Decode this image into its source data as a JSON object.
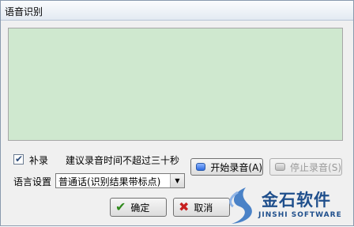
{
  "window": {
    "title": "语音识别"
  },
  "main": {
    "text_value": "",
    "supplement_label": "补录",
    "supplement_checked": true,
    "hint": "建议录音时间不超过三十秒",
    "start_button_label": "开始录音(A)",
    "stop_button_label": "停止录音(S)",
    "language_label": "语言设置",
    "language_selected": "普通话(识别结果带标点)"
  },
  "footer": {
    "ok_label": "确定",
    "cancel_label": "取消"
  },
  "watermark": {
    "brand_cn": "金石软件",
    "brand_en": "JINSHI SOFTWARE"
  },
  "colors": {
    "text_area_bg": "#cfe8cf",
    "brand_blue": "#1f4f8c"
  }
}
